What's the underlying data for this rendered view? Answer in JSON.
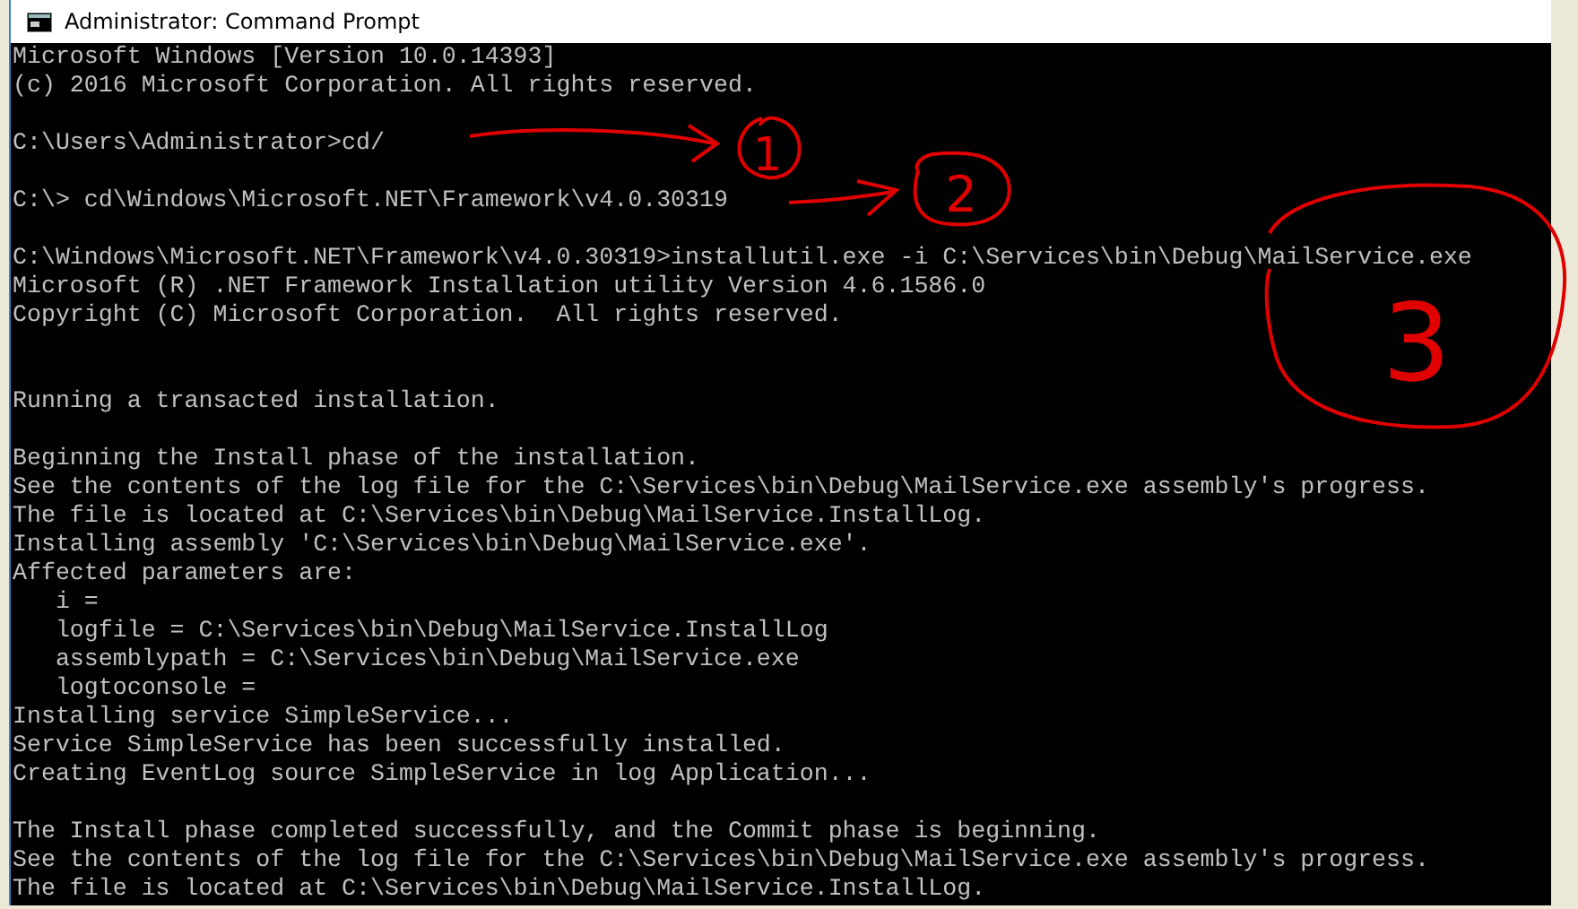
{
  "window": {
    "title": "Administrator: Command Prompt"
  },
  "console": {
    "lines": [
      {
        "kind": "text",
        "text": "Microsoft Windows [Version 10.0.14393]"
      },
      {
        "kind": "text",
        "text": "(c) 2016 Microsoft Corporation. All rights reserved."
      },
      {
        "kind": "blank"
      },
      {
        "kind": "text",
        "text": "C:\\Users\\Administrator>cd/"
      },
      {
        "kind": "blank"
      },
      {
        "kind": "text",
        "text": "C:\\> cd\\Windows\\Microsoft.NET\\Framework\\v4.0.30319"
      },
      {
        "kind": "blank"
      },
      {
        "kind": "text",
        "text": "C:\\Windows\\Microsoft.NET\\Framework\\v4.0.30319>installutil.exe -i C:\\Services\\bin\\Debug\\MailService.exe"
      },
      {
        "kind": "text",
        "text": "Microsoft (R) .NET Framework Installation utility Version 4.6.1586.0"
      },
      {
        "kind": "text",
        "text": "Copyright (C) Microsoft Corporation.  All rights reserved."
      },
      {
        "kind": "blank"
      },
      {
        "kind": "blank"
      },
      {
        "kind": "text",
        "text": "Running a transacted installation."
      },
      {
        "kind": "blank"
      },
      {
        "kind": "text",
        "text": "Beginning the Install phase of the installation."
      },
      {
        "kind": "text",
        "text": "See the contents of the log file for the C:\\Services\\bin\\Debug\\MailService.exe assembly's progress."
      },
      {
        "kind": "text",
        "text": "The file is located at C:\\Services\\bin\\Debug\\MailService.InstallLog."
      },
      {
        "kind": "text",
        "text": "Installing assembly 'C:\\Services\\bin\\Debug\\MailService.exe'."
      },
      {
        "kind": "text",
        "text": "Affected parameters are:"
      },
      {
        "kind": "text",
        "text": "   i ="
      },
      {
        "kind": "text",
        "text": "   logfile = C:\\Services\\bin\\Debug\\MailService.InstallLog"
      },
      {
        "kind": "text",
        "text": "   assemblypath = C:\\Services\\bin\\Debug\\MailService.exe"
      },
      {
        "kind": "text",
        "text": "   logtoconsole ="
      },
      {
        "kind": "text",
        "text": "Installing service SimpleService..."
      },
      {
        "kind": "text",
        "text": "Service SimpleService has been successfully installed."
      },
      {
        "kind": "text",
        "text": "Creating EventLog source SimpleService in log Application..."
      },
      {
        "kind": "blank"
      },
      {
        "kind": "text",
        "text": "The Install phase completed successfully, and the Commit phase is beginning."
      },
      {
        "kind": "text",
        "text": "See the contents of the log file for the C:\\Services\\bin\\Debug\\MailService.exe assembly's progress."
      },
      {
        "kind": "text",
        "text": "The file is located at C:\\Services\\bin\\Debug\\MailService.InstallLog."
      }
    ]
  },
  "annotations": [
    {
      "label": "1"
    },
    {
      "label": "2"
    },
    {
      "label": "3"
    }
  ]
}
